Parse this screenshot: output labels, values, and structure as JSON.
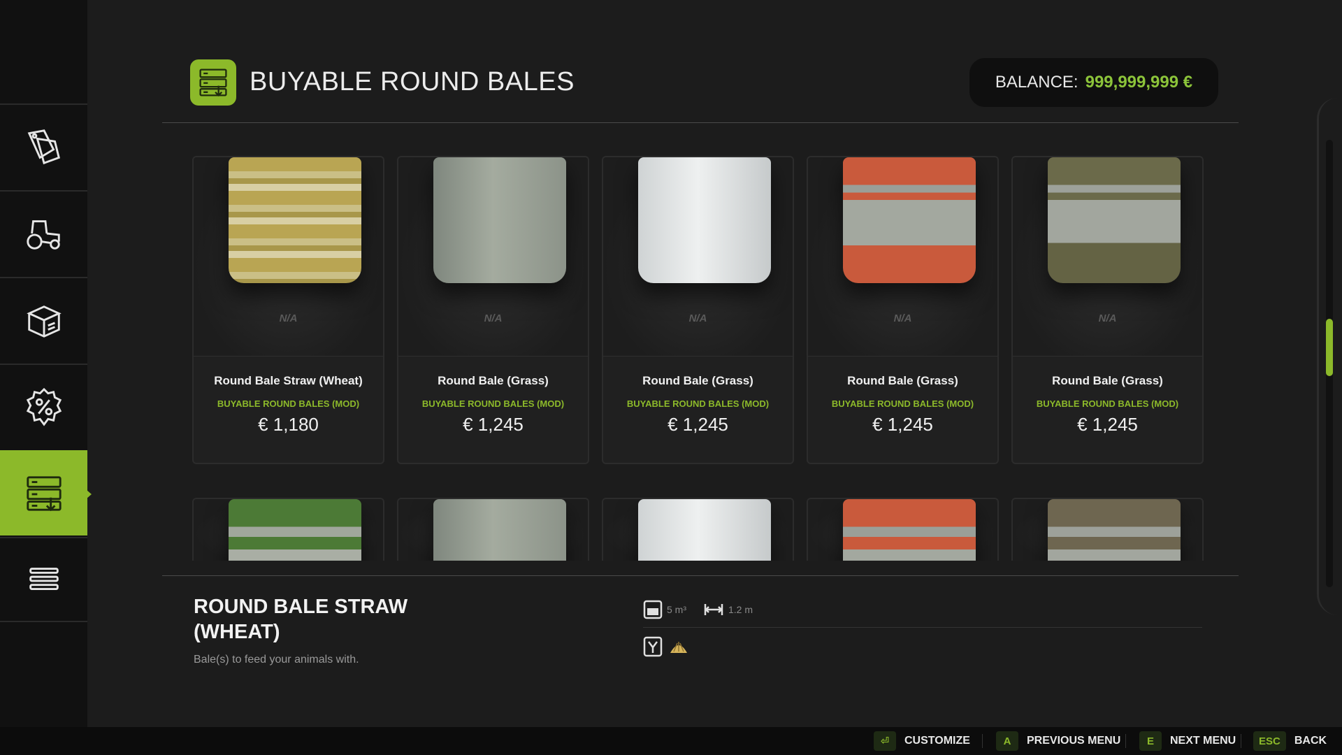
{
  "header": {
    "title": "BUYABLE ROUND BALES",
    "balance_label": "BALANCE:",
    "balance_value": "999,999,999 €",
    "icon": "bale-shop-icon"
  },
  "sidebar": {
    "items": [
      {
        "icon": "price-tag-icon",
        "active": false
      },
      {
        "icon": "tractor-icon",
        "active": false
      },
      {
        "icon": "storage-box-icon",
        "active": false
      },
      {
        "icon": "percent-icon",
        "active": false
      },
      {
        "icon": "bale-shop-icon",
        "active": true
      },
      {
        "icon": "list-menu-icon",
        "active": false
      }
    ]
  },
  "products": [
    {
      "name": "Round Bale Straw (Wheat)",
      "source": "BUYABLE ROUND BALES (MOD)",
      "price": "€ 1,180",
      "availability": "N/A",
      "wrap": "straw-yellow"
    },
    {
      "name": "Round Bale (Grass)",
      "source": "BUYABLE ROUND BALES (MOD)",
      "price": "€ 1,245",
      "availability": "N/A",
      "wrap": "grass-grey"
    },
    {
      "name": "Round Bale (Grass)",
      "source": "BUYABLE ROUND BALES (MOD)",
      "price": "€ 1,245",
      "availability": "N/A",
      "wrap": "white"
    },
    {
      "name": "Round Bale (Grass)",
      "source": "BUYABLE ROUND BALES (MOD)",
      "price": "€ 1,245",
      "availability": "N/A",
      "wrap": "red-striped"
    },
    {
      "name": "Round Bale (Grass)",
      "source": "BUYABLE ROUND BALES (MOD)",
      "price": "€ 1,245",
      "availability": "N/A",
      "wrap": "olive-striped"
    }
  ],
  "second_row_wraps": [
    "green-striped",
    "grass-grey",
    "white",
    "red-striped",
    "brown-striped"
  ],
  "detail": {
    "title": "ROUND BALE STRAW (WHEAT)",
    "description": "Bale(s) to feed your animals with.",
    "volume": "5 m³",
    "width": "1.2 m"
  },
  "footer": {
    "customize": "CUSTOMIZE",
    "prev_key": "A",
    "prev_label": "PREVIOUS MENU",
    "next_key": "E",
    "next_label": "NEXT MENU",
    "back_key": "ESC",
    "back_label": "BACK"
  },
  "colors": {
    "accent": "#8cb92a",
    "balance": "#8cc43a"
  }
}
